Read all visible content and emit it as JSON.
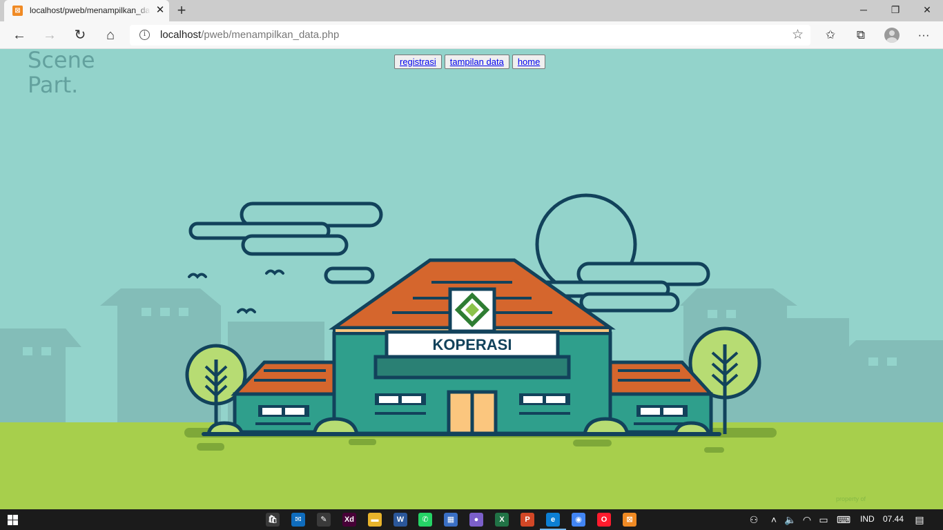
{
  "browser": {
    "tab": {
      "title": "localhost/pweb/menampilkan_data.php",
      "favicon_glyph": "⊠",
      "close_glyph": "✕"
    },
    "new_tab_glyph": "+",
    "window_controls": {
      "minimize": "─",
      "restore": "❐",
      "close": "✕"
    },
    "nav": {
      "back": "←",
      "forward": "→",
      "reload": "↻",
      "home": "⌂"
    },
    "address": {
      "host": "localhost",
      "path": "/pweb/menampilkan_data.php",
      "info_glyph": "i",
      "favorite_glyph": "☆"
    },
    "toolbar_icons": {
      "favorites": "✩",
      "collections": "⧉",
      "menu": "···"
    }
  },
  "page": {
    "scene_label_line1": "Scene",
    "scene_label_line2": "Part.",
    "nav_buttons": [
      {
        "label": "registrasi"
      },
      {
        "label": "tampilan data"
      },
      {
        "label": "home"
      }
    ],
    "building_sign": "KOPERASI",
    "property_text": "property of",
    "colors": {
      "sky": "#93d3cb",
      "ground": "#a7cf4c",
      "outline": "#12425b",
      "roof": "#d5662d",
      "wall": "#2f9f8c",
      "door": "#fbc67e",
      "tree": "#b7dc73",
      "bg_buildings": "#83bdb8"
    }
  },
  "taskbar": {
    "apps": [
      {
        "name": "store",
        "glyph": "🛍",
        "color": "#3a3a3a"
      },
      {
        "name": "mail",
        "glyph": "✉",
        "color": "#0f6cbd"
      },
      {
        "name": "paint",
        "glyph": "✎",
        "color": "#3a3a3a"
      },
      {
        "name": "adobe-xd",
        "glyph": "Xd",
        "color": "#470137"
      },
      {
        "name": "file-explorer",
        "glyph": "▬",
        "color": "#e8b42b"
      },
      {
        "name": "word",
        "glyph": "W",
        "color": "#2b579a"
      },
      {
        "name": "whatsapp",
        "glyph": "✆",
        "color": "#25d366"
      },
      {
        "name": "terminal",
        "glyph": "▦",
        "color": "#3a6fc4"
      },
      {
        "name": "teams",
        "glyph": "●",
        "color": "#7b5fc9"
      },
      {
        "name": "excel",
        "glyph": "X",
        "color": "#217346"
      },
      {
        "name": "powerpoint",
        "glyph": "P",
        "color": "#d24726"
      },
      {
        "name": "edge",
        "glyph": "e",
        "color": "#0c7fd4"
      },
      {
        "name": "chrome",
        "glyph": "◉",
        "color": "#4285f4"
      },
      {
        "name": "opera",
        "glyph": "O",
        "color": "#ff1b2d"
      },
      {
        "name": "xampp",
        "glyph": "⊠",
        "color": "#f08a24"
      }
    ],
    "tray": {
      "language": "IND",
      "time": "07.44"
    }
  }
}
